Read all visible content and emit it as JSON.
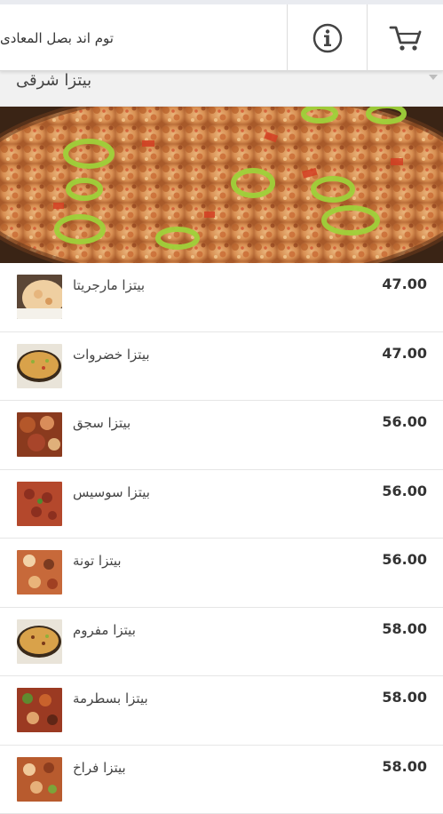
{
  "header": {
    "store_name": "توم اند بصل المعادى",
    "cart_icon": "cart-icon",
    "info_icon": "info-icon"
  },
  "category": {
    "title": "بيتزا شرقى"
  },
  "colors": {
    "price_text": "#333333",
    "divider": "#e6e6e6",
    "category_bg": "#f1f1f1"
  },
  "menu": {
    "items": [
      {
        "name": "بيتزا مارجريتا",
        "price": "47.00",
        "thumb": "margherita"
      },
      {
        "name": "بيتزا خضروات",
        "price": "47.00",
        "thumb": "veg"
      },
      {
        "name": "بيتزا سجق",
        "price": "56.00",
        "thumb": "sausage"
      },
      {
        "name": "بيتزا سوسيس",
        "price": "56.00",
        "thumb": "sosis"
      },
      {
        "name": "بيتزا تونة",
        "price": "56.00",
        "thumb": "tuna"
      },
      {
        "name": "بيتزا مفروم",
        "price": "58.00",
        "thumb": "minced"
      },
      {
        "name": "بيتزا بسطرمة",
        "price": "58.00",
        "thumb": "pastrami"
      },
      {
        "name": "بيتزا فراخ",
        "price": "58.00",
        "thumb": "chicken"
      }
    ]
  }
}
